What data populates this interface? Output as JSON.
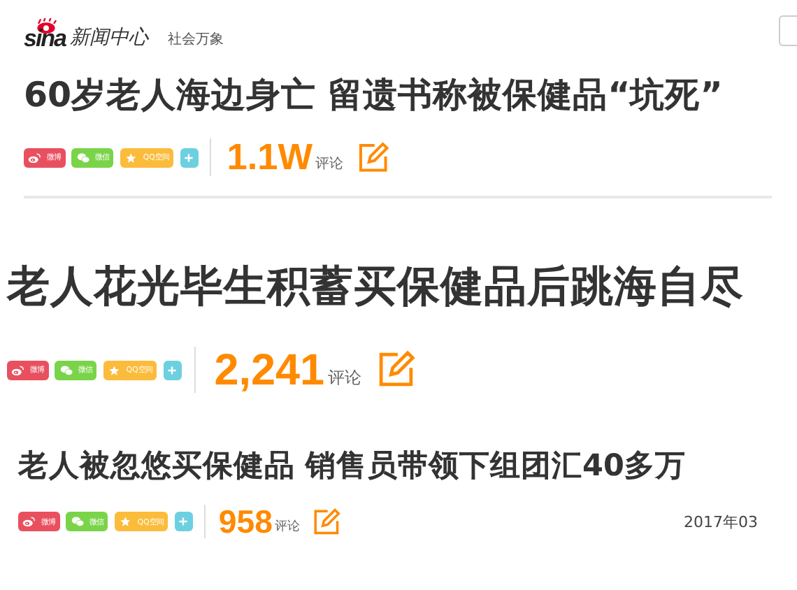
{
  "header": {
    "logo": "sina",
    "site": "新闻中心",
    "channel": "社会万象"
  },
  "articles": [
    {
      "headline": "60岁老人海边身亡 留遗书称被保健品“坑死”",
      "shares": [
        {
          "kind": "weibo",
          "label": "微博"
        },
        {
          "kind": "wechat",
          "label": "微信"
        },
        {
          "kind": "qzone",
          "label": "QQ空间"
        },
        {
          "kind": "more"
        }
      ],
      "comment_count": "1.1W",
      "comment_label": "评论"
    },
    {
      "headline": "老人花光毕生积蓄买保健品后跳海自尽",
      "shares": [
        {
          "kind": "weibo",
          "label": "微博"
        },
        {
          "kind": "wechat",
          "label": "微信"
        },
        {
          "kind": "qzone",
          "label": "QQ空间"
        },
        {
          "kind": "more"
        }
      ],
      "comment_count": "2,241",
      "comment_label": "评论"
    },
    {
      "headline": "老人被忽悠买保健品 销售员带领下组团汇40多万",
      "shares": [
        {
          "kind": "weibo",
          "label": "微博"
        },
        {
          "kind": "wechat",
          "label": "微信"
        },
        {
          "kind": "qzone",
          "label": "QQ空间"
        },
        {
          "kind": "more"
        }
      ],
      "comment_count": "958",
      "comment_label": "评论",
      "date": "2017年03"
    }
  ]
}
